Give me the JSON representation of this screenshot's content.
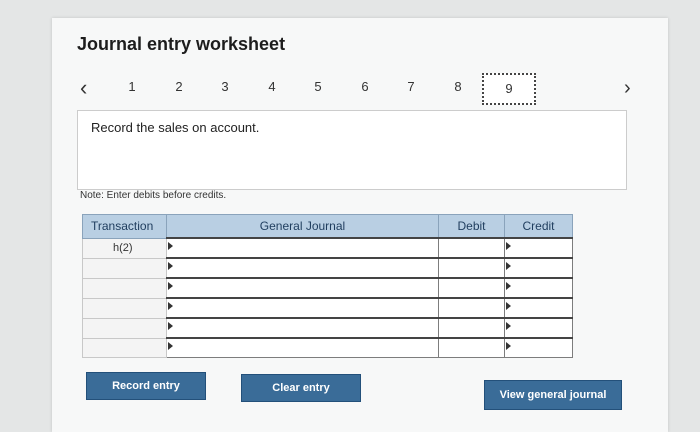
{
  "worksheet": {
    "title": "Journal entry worksheet",
    "pages": [
      "1",
      "2",
      "3",
      "4",
      "5",
      "6",
      "7",
      "8",
      "9"
    ],
    "active_page": "9",
    "prev_label": "‹",
    "next_label": "›",
    "instruction": "Record the sales on account.",
    "note": "Note: Enter debits before credits."
  },
  "table": {
    "headers": {
      "transaction": "Transaction",
      "journal": "General Journal",
      "debit": "Debit",
      "credit": "Credit"
    },
    "rows": [
      {
        "transaction": "h(2)"
      },
      {
        "transaction": ""
      },
      {
        "transaction": ""
      },
      {
        "transaction": ""
      },
      {
        "transaction": ""
      },
      {
        "transaction": ""
      }
    ]
  },
  "buttons": {
    "record": "Record entry",
    "clear": "Clear entry",
    "view": "View general journal"
  }
}
